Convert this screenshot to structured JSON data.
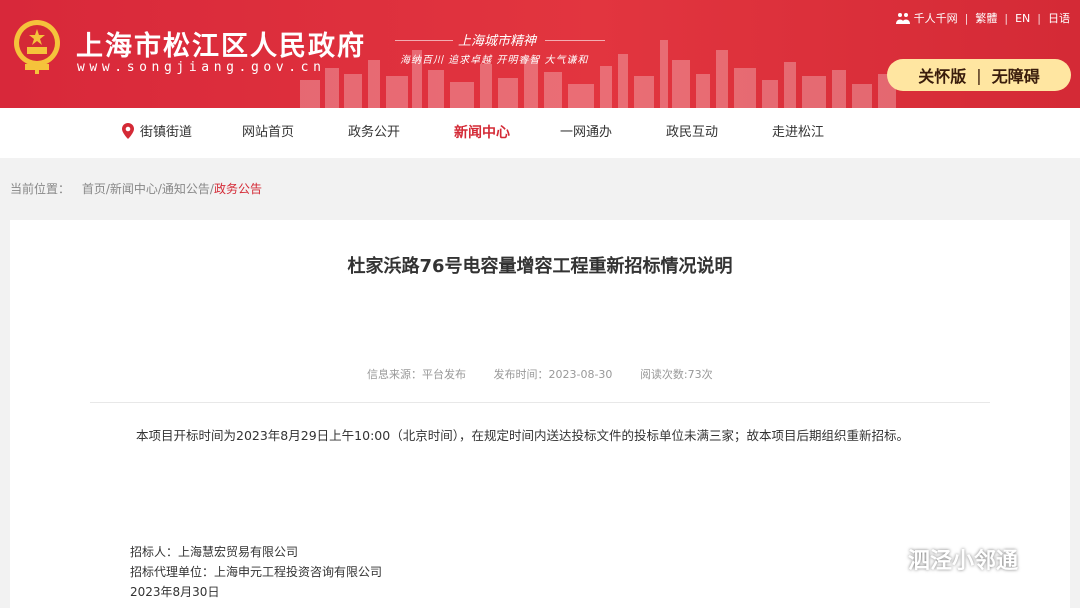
{
  "header": {
    "site_title": "上海市松江区人民政府",
    "site_url": "www.songjiang.gov.cn",
    "spirit_title": "上海城市精神",
    "spirit_slogan": "海纳百川 追求卓越 开明睿智 大气谦和",
    "top_links": [
      "千人千网",
      "繁體",
      "EN",
      "日语"
    ],
    "elder_label": "关怀版",
    "accessible_label": "无障碍",
    "divider": "|",
    "colors": {
      "brand_red": "#d8283a",
      "button_bg": "#ffe6a1"
    }
  },
  "nav": {
    "items": [
      "街镇街道",
      "网站首页",
      "政务公开",
      "新闻中心",
      "一网通办",
      "政民互动",
      "走进松江"
    ],
    "active": "新闻中心"
  },
  "breadcrumb": {
    "label": "当前位置：",
    "path": "首页/新闻中心/通知公告/",
    "current": "政务公告"
  },
  "article": {
    "title": "杜家浜路76号电容量增容工程重新招标情况说明",
    "source": "信息来源：平台发布",
    "date": "发布时间：2023-08-30",
    "views": "阅读次数:73次",
    "body": "本项目开标时间为2023年8月29日上午10:00（北京时间），在规定时间内送达投标文件的投标单位未满三家；故本项目后期组织重新招标。",
    "tenderer": "招标人：上海慧宏贸易有限公司",
    "agent": "招标代理单位：上海申元工程投资咨询有限公司",
    "sign_date": "2023年8月30日"
  },
  "watermark": {
    "text": "泗泾小邻通",
    "icon": "wechat-icon"
  }
}
